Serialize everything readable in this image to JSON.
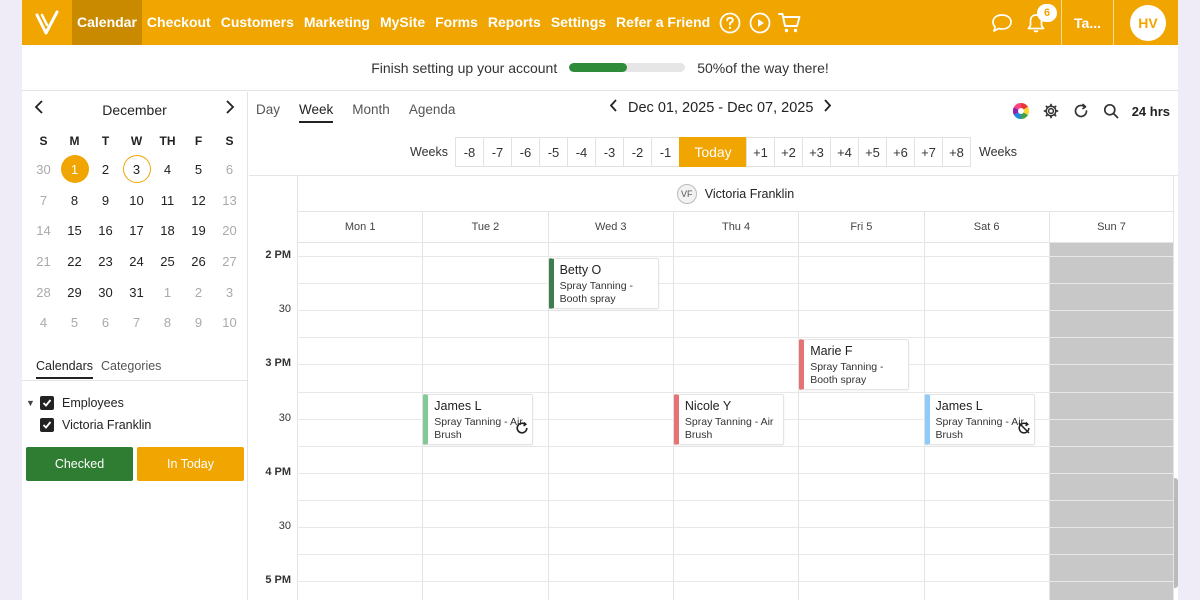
{
  "nav": {
    "items": [
      "Calendar",
      "Checkout",
      "Customers",
      "Marketing",
      "MySite",
      "Forms",
      "Reports",
      "Settings",
      "Refer a Friend"
    ],
    "active": "Calendar",
    "notification_count": "6",
    "account_short": "Ta...",
    "avatar_initials": "HV"
  },
  "setup": {
    "message": "Finish setting up your account",
    "progress": 0.5,
    "progress_text": "50%of the way there!"
  },
  "mini_calendar": {
    "month": "December",
    "days_of_week": [
      "S",
      "M",
      "T",
      "W",
      "TH",
      "F",
      "S"
    ],
    "weeks": [
      [
        "30",
        "1",
        "2",
        "3",
        "4",
        "5",
        "6"
      ],
      [
        "7",
        "8",
        "9",
        "10",
        "11",
        "12",
        "13"
      ],
      [
        "14",
        "15",
        "16",
        "17",
        "18",
        "19",
        "20"
      ],
      [
        "21",
        "22",
        "23",
        "24",
        "25",
        "26",
        "27"
      ],
      [
        "28",
        "29",
        "30",
        "31",
        "1",
        "2",
        "3"
      ],
      [
        "4",
        "5",
        "6",
        "7",
        "8",
        "9",
        "10"
      ]
    ],
    "selected_day": "1",
    "today_day": "3"
  },
  "sidebar": {
    "tabs": [
      "Calendars",
      "Categories"
    ],
    "active_tab": "Calendars",
    "group_label": "Employees",
    "employee_label": "Victoria Franklin",
    "checked_button": "Checked",
    "today_button": "In Today"
  },
  "toolbar": {
    "views": [
      "Day",
      "Week",
      "Month",
      "Agenda"
    ],
    "active_view": "Week",
    "date_range": "Dec 01, 2025 - Dec 07, 2025",
    "hours_label": "24 hrs"
  },
  "weeks_nav": {
    "label": "Weeks",
    "minus": [
      "-8",
      "-7",
      "-6",
      "-5",
      "-4",
      "-3",
      "-2",
      "-1"
    ],
    "today": "Today",
    "plus": [
      "+1",
      "+2",
      "+3",
      "+4",
      "+5",
      "+6",
      "+7",
      "+8"
    ]
  },
  "schedule": {
    "staff_initials": "VF",
    "staff_name": "Victoria Franklin",
    "days": [
      "Mon 1",
      "Tue 2",
      "Wed 3",
      "Thu 4",
      "Fri 5",
      "Sat 6",
      "Sun 7"
    ],
    "off_day_index": 6,
    "time_labels": [
      "2 PM",
      "30",
      "3 PM",
      "30",
      "4 PM",
      "30",
      "5 PM"
    ],
    "appointments": [
      {
        "name": "Betty O",
        "service": "Spray Tanning - Booth spray",
        "day": 2,
        "start": 0.0,
        "color": "#3d7d4f",
        "recurring": false
      },
      {
        "name": "Marie F",
        "service": "Spray Tanning - Booth spray",
        "day": 4,
        "start": 1.5,
        "color": "#e57373",
        "recurring": false
      },
      {
        "name": "James L",
        "service": "Spray Tanning - Air Brush",
        "day": 1,
        "start": 2.5,
        "color": "#81c995",
        "recurring": true
      },
      {
        "name": "Nicole Y",
        "service": "Spray Tanning - Air Brush",
        "day": 3,
        "start": 2.5,
        "color": "#e57373",
        "recurring": false
      },
      {
        "name": "James L",
        "service": "Spray Tanning - Air Brush",
        "day": 5,
        "start": 2.5,
        "color": "#90caf9",
        "recurring": "cancel"
      }
    ]
  },
  "colors": {
    "accent": "#f0a500",
    "green": "#2e7d32",
    "off_day": "#c8c8c8"
  }
}
